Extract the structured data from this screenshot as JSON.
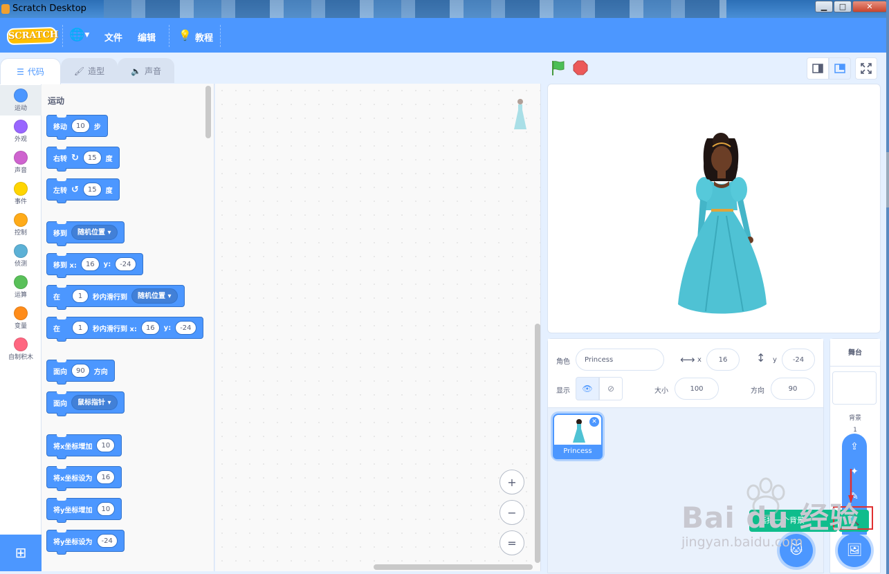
{
  "window": {
    "title": "Scratch Desktop",
    "minimize": "▁",
    "maximize": "□",
    "close": "✕"
  },
  "menubar": {
    "logo": "SCRATCH",
    "language_icon": "globe-icon",
    "file": "文件",
    "edit": "编辑",
    "tutorials": "教程"
  },
  "tabs": [
    {
      "label": "代码",
      "icon": "code-icon"
    },
    {
      "label": "造型",
      "icon": "brush-icon"
    },
    {
      "label": "声音",
      "icon": "speaker-icon"
    }
  ],
  "categories": [
    {
      "label": "运动",
      "color": "#4c97ff"
    },
    {
      "label": "外观",
      "color": "#9966ff"
    },
    {
      "label": "声音",
      "color": "#cf63cf"
    },
    {
      "label": "事件",
      "color": "#ffd500"
    },
    {
      "label": "控制",
      "color": "#ffab19"
    },
    {
      "label": "侦测",
      "color": "#5cb1d6"
    },
    {
      "label": "运算",
      "color": "#59c059"
    },
    {
      "label": "变量",
      "color": "#ff8c1a"
    },
    {
      "label": "自制积木",
      "color": "#ff6680"
    }
  ],
  "palette": {
    "title": "运动",
    "blocks": {
      "move": {
        "a": "移动",
        "v": "10",
        "b": "步"
      },
      "turn_right": {
        "a": "右转",
        "v": "15",
        "b": "度"
      },
      "turn_left": {
        "a": "左转",
        "v": "15",
        "b": "度"
      },
      "goto": {
        "a": "移到",
        "dd": "随机位置"
      },
      "goto_xy": {
        "a": "移到 x:",
        "x": "16",
        "b": "y:",
        "y": "-24"
      },
      "glide": {
        "a": "在",
        "v": "1",
        "b": "秒内滑行到",
        "dd": "随机位置"
      },
      "glide_xy": {
        "a": "在",
        "v": "1",
        "b": "秒内滑行到 x:",
        "x": "16",
        "c": "y:",
        "y": "-24"
      },
      "point_dir": {
        "a": "面向",
        "v": "90",
        "b": "方向"
      },
      "point_towards": {
        "a": "面向",
        "dd": "鼠标指针"
      },
      "change_x": {
        "a": "将x坐标增加",
        "v": "10"
      },
      "set_x": {
        "a": "将x坐标设为",
        "v": "16"
      },
      "change_y": {
        "a": "将y坐标增加",
        "v": "10"
      },
      "set_y": {
        "a": "将y坐标设为",
        "v": "-24"
      }
    }
  },
  "workspace": {
    "zoom_in": "+",
    "zoom_out": "−",
    "zoom_reset": "="
  },
  "sprite_info": {
    "sprite_label": "角色",
    "sprite_name": "Princess",
    "x_label": "x",
    "x": "16",
    "y_label": "y",
    "y": "-24",
    "show_label": "显示",
    "size_label": "大小",
    "size": "100",
    "direction_label": "方向",
    "direction": "90"
  },
  "sprites": [
    {
      "name": "Princess",
      "selected": true
    }
  ],
  "stage_target": {
    "header": "舞台",
    "backdrops_label": "背景",
    "backdrop_count": "1"
  },
  "backdrop_menu": {
    "tooltip": "选择一个背景"
  },
  "watermark": {
    "brand": "Bai du 经验",
    "url": "jingyan.baidu.com"
  },
  "colors": {
    "accent": "#4c97ff",
    "motion": "#4c97ff",
    "highlight": "#e03030",
    "search_green": "#0fbd8c"
  }
}
